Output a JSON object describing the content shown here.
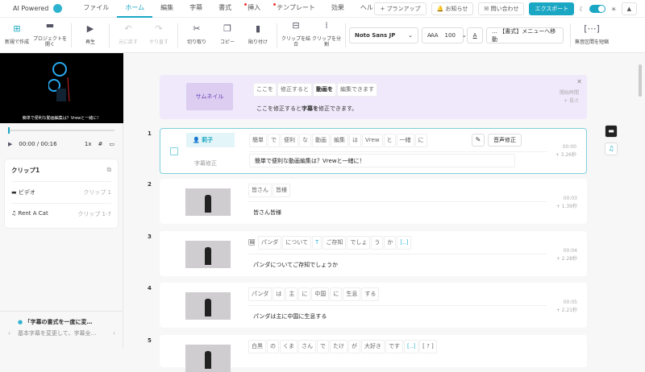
{
  "menubar": {
    "brand": "AI Powered",
    "items": [
      "ファイル",
      "ホーム",
      "編集",
      "字幕",
      "書式",
      "挿入",
      "テンプレート",
      "効果",
      "ヘルプ"
    ],
    "active": 1,
    "plan": "+ プランアップ",
    "notice": "🔔 お知らせ",
    "contact": "✉ 問い合わせ",
    "export": "エクスポート"
  },
  "toolbar": {
    "new": "新規で作成",
    "open": "プロジェクトを開く",
    "play": "再生",
    "undo": "元に戻す",
    "redo": "やり直す",
    "cut": "切り取り",
    "copy": "コピー",
    "paste": "貼り付け",
    "merge": "クリップを結合",
    "split": "クリップを分割",
    "font": "Noto Sans JP",
    "size": "100",
    "format_menu": "…  【書式】メニューへ移動",
    "silence": "無音区間を短縮"
  },
  "player": {
    "caption": "簡単で便利な動画編集は？Vrewと一緒に！",
    "time": "00:00 / 00:16",
    "speed": "1x"
  },
  "clip_panel": {
    "title": "クリップ1",
    "rows": [
      {
        "label": "ビデオ",
        "value": "クリップ 1"
      },
      {
        "label": "Rent A Cat",
        "value": "クリップ 1-7"
      }
    ]
  },
  "tip": {
    "title": "「字幕の書式を一度に変…",
    "body": "基本字幕を変更して、字幕全…"
  },
  "banner": {
    "thumb": "サムネイル",
    "words": [
      "ここを",
      "修正すると",
      "動画を",
      "編集できます"
    ],
    "subtitle_pre": "ここを修正すると",
    "subtitle_bold": "字幕を",
    "subtitle_post": "修正できます。",
    "time1": "開始時間",
    "time2": "+ 長さ"
  },
  "clips": [
    {
      "num": "1",
      "speaker": "莉子",
      "sub_label": "字幕修正",
      "words": [
        "簡単",
        "で",
        "便利",
        "な",
        "動画",
        "編集",
        "は",
        "Vrew",
        "と",
        "一緒",
        "に"
      ],
      "subtitle": "簡単で便利な動画編集は？Vrewと一緒に！",
      "start": "00:00",
      "dur": "+ 3.26秒",
      "voice": "音声修正"
    },
    {
      "num": "2",
      "words": [
        "皆さん",
        "皆様"
      ],
      "subtitle": "皆さん皆様",
      "start": "00:03",
      "dur": "+ 1.39秒"
    },
    {
      "num": "3",
      "words": [
        "パンダ",
        "について",
        "T",
        "ご存知",
        "でしょ",
        "う",
        "か",
        "[‥]"
      ],
      "subtitle": "パンダについてご存知でしょうか",
      "start": "00:04",
      "dur": "+ 2.28秒"
    },
    {
      "num": "4",
      "words": [
        "パンダ",
        "は",
        "主",
        "に",
        "中国",
        "に",
        "生息",
        "する"
      ],
      "subtitle": "パンダは主に中国に生息する",
      "start": "00:05",
      "dur": "+ 2.21秒"
    },
    {
      "num": "5",
      "words": [
        "白黒",
        "の",
        "くま",
        "さん",
        "で",
        "たけ",
        "が",
        "大好き",
        "です",
        "[‥]",
        "[ ? ]"
      ]
    }
  ]
}
